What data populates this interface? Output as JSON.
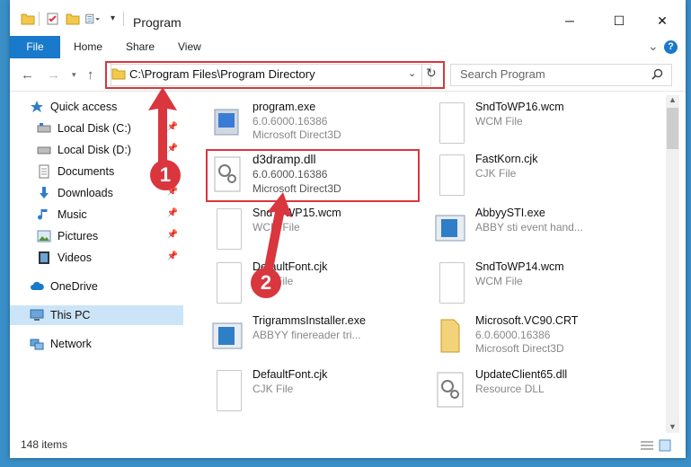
{
  "window": {
    "title": "Program",
    "minimize": "─",
    "maximize": "☐",
    "close": "✕"
  },
  "ribbon": {
    "file": "File",
    "tabs": [
      "Home",
      "Share",
      "View"
    ],
    "expand": "⌄",
    "help": "?"
  },
  "address": {
    "path": "C:\\Program Files\\Program Directory",
    "search_placeholder": "Search Program"
  },
  "nav": {
    "quick_access": "Quick access",
    "items": [
      {
        "label": "Local Disk (C:)"
      },
      {
        "label": "Local Disk (D:)"
      },
      {
        "label": "Documents"
      },
      {
        "label": "Downloads"
      },
      {
        "label": "Music"
      },
      {
        "label": "Pictures"
      },
      {
        "label": "Videos"
      }
    ],
    "onedrive": "OneDrive",
    "this_pc": "This PC",
    "network": "Network"
  },
  "files": {
    "left": [
      {
        "name": "program.exe",
        "line1": "6.0.6000.16386",
        "line2": "Microsoft Direct3D"
      },
      {
        "name": "d3dramp.dll",
        "line1": "6.0.6000.16386",
        "line2": "Microsoft Direct3D"
      },
      {
        "name": "SndToWP15.wcm",
        "line1": "WCM File",
        "line2": ""
      },
      {
        "name": "DefaultFont.cjk",
        "line1": "CJK File",
        "line2": ""
      },
      {
        "name": "TrigrammsInstaller.exe",
        "line1": "ABBYY finereader tri...",
        "line2": ""
      },
      {
        "name": "DefaultFont.cjk",
        "line1": "CJK File",
        "line2": ""
      }
    ],
    "right": [
      {
        "name": "SndToWP16.wcm",
        "line1": "WCM File",
        "line2": ""
      },
      {
        "name": "FastKorn.cjk",
        "line1": "CJK File",
        "line2": ""
      },
      {
        "name": "AbbyySTI.exe",
        "line1": "ABBY sti event hand...",
        "line2": ""
      },
      {
        "name": "SndToWP14.wcm",
        "line1": "WCM File",
        "line2": ""
      },
      {
        "name": "Microsoft.VC90.CRT",
        "line1": "6.0.6000.16386",
        "line2": "Microsoft Direct3D"
      },
      {
        "name": "UpdateClient65.dll",
        "line1": "Resource DLL",
        "line2": ""
      }
    ]
  },
  "status": {
    "count": "148 items"
  },
  "annotations": {
    "step1": "1",
    "step2": "2"
  },
  "colors": {
    "accent": "#1979ca",
    "highlight": "#d9363e",
    "selected": "#cce4f7"
  }
}
